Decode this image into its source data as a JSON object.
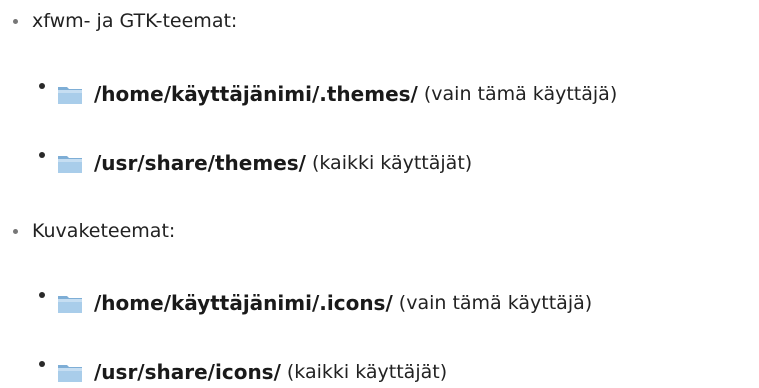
{
  "sections": [
    {
      "label": "xfwm- ja GTK-teemat:",
      "items": [
        {
          "icon": "folder-icon",
          "path": "/home/käyttäjänimi/.themes/",
          "note": "(vain tämä käyttäjä)"
        },
        {
          "icon": "folder-icon",
          "path": "/usr/share/themes/",
          "note": "(kaikki käyttäjät)"
        }
      ]
    },
    {
      "label": "Kuvaketeemat:",
      "items": [
        {
          "icon": "folder-icon",
          "path": "/home/käyttäjänimi/.icons/",
          "note": "(vain tämä käyttäjä)"
        },
        {
          "icon": "folder-icon",
          "path": "/usr/share/icons/",
          "note": "(kaikki käyttäjät)"
        }
      ]
    }
  ],
  "colors": {
    "text": "#222222",
    "folder_body": "#9ec6e8",
    "folder_tab": "#7eaed6"
  }
}
